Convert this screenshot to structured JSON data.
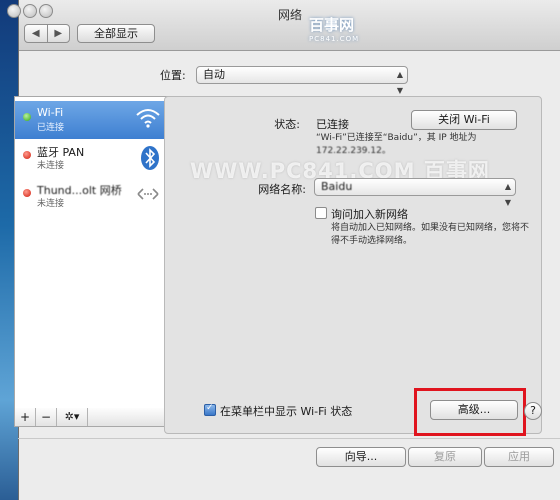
{
  "window": {
    "title": "网络"
  },
  "toolbar": {
    "back_label": "◀",
    "forward_label": "▶",
    "show_all_label": "全部显示"
  },
  "logo": {
    "text": "百事网",
    "subtext": "PC841.COM"
  },
  "location": {
    "label": "位置:",
    "value": "自动"
  },
  "services": [
    {
      "name": "Wi-Fi",
      "status": "已连接",
      "state_color": "#34a812",
      "icon": "wifi-icon"
    },
    {
      "name": "蓝牙 PAN",
      "status": "未连接",
      "state_color": "#d01b0b",
      "icon": "bluetooth-icon"
    },
    {
      "name": "Thund...olt 网桥",
      "status": "未连接",
      "state_color": "#d01b0b",
      "icon": "bridge-arrows-icon"
    }
  ],
  "list_footer": {
    "add": "+",
    "remove": "−",
    "gear": "✲▾"
  },
  "detail": {
    "status_label": "状态:",
    "status_value": "已连接",
    "toggle_wifi_button": "关闭 Wi-Fi",
    "status_desc_line1": "“Wi-Fi”已连接至“Baidu”，其 IP 地址为",
    "status_desc_line2": "172.22.239.12。",
    "network_name_label": "网络名称:",
    "network_name_value": "Baidu",
    "ask_join_label": "询问加入新网络",
    "ask_join_checked": false,
    "ask_join_desc_line1": "将自动加入已知网络。如果没有已知网络，您将不",
    "ask_join_desc_line2": "得不手动选择网络。",
    "show_in_menu_label": "在菜单栏中显示 Wi-Fi 状态",
    "show_in_menu_checked": true,
    "advanced_button": "高级...",
    "help_button": "?"
  },
  "watermark": "WWW.PC841.COM 百事网",
  "footer": {
    "assist_button": "向导...",
    "revert_button": "复原",
    "apply_button": "应用"
  },
  "colors": {
    "selection": "#3e7fd1",
    "highlight_box": "#e0141e"
  }
}
